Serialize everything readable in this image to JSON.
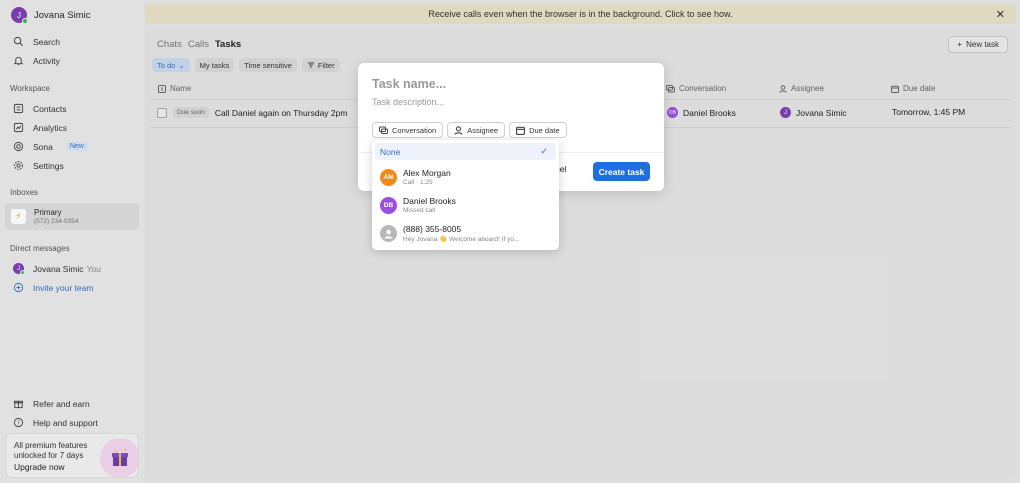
{
  "user": {
    "initial": "J",
    "name": "Jovana Simic"
  },
  "nav": [
    {
      "label": "Search",
      "icon": "search-icon"
    },
    {
      "label": "Activity",
      "icon": "bell-icon"
    }
  ],
  "workspace": {
    "label": "Workspace",
    "items": [
      {
        "label": "Contacts",
        "icon": "contacts-icon"
      },
      {
        "label": "Analytics",
        "icon": "analytics-icon"
      },
      {
        "label": "Sona",
        "icon": "sona-icon",
        "badge": "New"
      },
      {
        "label": "Settings",
        "icon": "gear-icon"
      }
    ]
  },
  "inboxes": {
    "label": "Inboxes",
    "primary": {
      "name": "Primary",
      "phone": "(572) 234-0354"
    }
  },
  "direct_messages": {
    "label": "Direct messages",
    "self": {
      "name": "Jovana Simic",
      "tag": "You"
    },
    "invite": "Invite your team"
  },
  "footer_nav": [
    {
      "label": "Refer and earn",
      "icon": "gift-icon"
    },
    {
      "label": "Help and support",
      "icon": "help-icon"
    }
  ],
  "premium": {
    "text": "All premium features unlocked for 7 days",
    "cta": "Upgrade now"
  },
  "banner": {
    "text": "Receive calls even when the browser is in the background. Click to see how.",
    "close": "✕"
  },
  "tabs": [
    "Chats",
    "Calls",
    "Tasks"
  ],
  "new_task": "New task",
  "filters": {
    "todo": "To do",
    "my_tasks": "My tasks",
    "time_sensitive": "Time sensitive",
    "filter": "Filter"
  },
  "columns": {
    "name": "Name",
    "conversation": "Conversation",
    "assignee": "Assignee",
    "due_date": "Due date"
  },
  "task": {
    "tag": "Due soon",
    "title": "Call Daniel again on Thursday 2pm",
    "conversation": {
      "initials": "DB",
      "name": "Daniel Brooks"
    },
    "assignee": {
      "initial": "J",
      "name": "Jovana Simic"
    },
    "due": "Tomorrow, 1:45 PM"
  },
  "modal": {
    "name_placeholder": "Task name...",
    "desc_placeholder": "Task description...",
    "chips": {
      "conversation": "Conversation",
      "assignee": "Assignee",
      "due_date": "Due date"
    },
    "cancel": "ancel",
    "create": "Create task"
  },
  "dropdown": {
    "none": "None",
    "check": "✓",
    "items": [
      {
        "initials": "AM",
        "name": "Alex Morgan",
        "sub": "Call · 1:25",
        "color": "#f08a1c"
      },
      {
        "initials": "DB",
        "name": "Daniel Brooks",
        "sub": "Missed call",
        "color": "#9b4fe0"
      },
      {
        "initials": "",
        "name": "(888) 355-8005",
        "sub": "Hey Jovana 👋 Welcome aboard! If yo...",
        "color": "#b8b8b8"
      }
    ]
  }
}
